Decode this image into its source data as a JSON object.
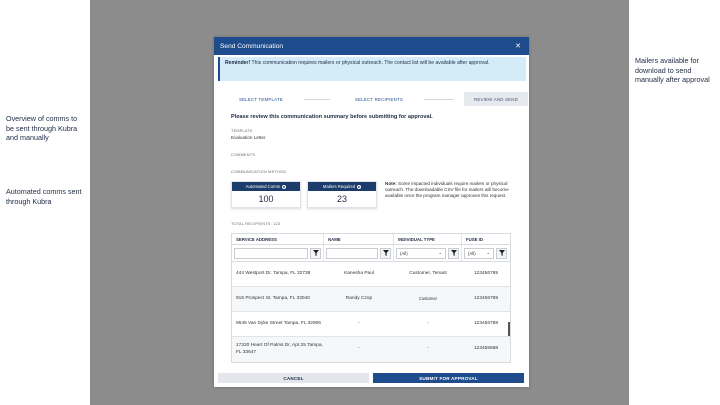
{
  "annotations": {
    "left_top": "Overview of comms to be sent through Kubra and manually",
    "left_bottom": "Automated comms sent through Kubra",
    "right_top": "Mailers available for download to send manually after approval"
  },
  "modal": {
    "title": "Send Communication",
    "close_icon": "close-icon",
    "reminder_bold": "Reminder!",
    "reminder_text": " This communication requires mailers or physical outreach. The contact list will be available after approval."
  },
  "steps": [
    {
      "label": "SELECT TEMPLATE",
      "active": false
    },
    {
      "label": "SELECT RECIPIENTS",
      "active": false
    },
    {
      "label": "REVIEW AND SEND",
      "active": true
    }
  ],
  "summary": {
    "title": "Please review this communication summary before submitting for approval.",
    "template_label": "TEMPLATE",
    "template_value": "Evaluation Letter",
    "comments_label": "COMMENTS",
    "method_label": "COMMUNICATION METHOD"
  },
  "cards": {
    "automated": {
      "label": "Automated Comm",
      "value": "100"
    },
    "mailers": {
      "label": "Mailers Required",
      "value": "23"
    }
  },
  "note": {
    "bold": "Note:",
    "text": " Some impacted individuals require mailers or physical outreach. The downloadable CSV file for mailers will become available once the program manager approves this request."
  },
  "table": {
    "total_label": "TOTAL RECIPIENTS: 123",
    "headers": [
      "SERVICE ADDRESS",
      "NAME",
      "INDIVIDUAL TYPE",
      "FUSE ID"
    ],
    "filters": {
      "type": "(All)",
      "fuse": "(All)"
    },
    "rows": [
      {
        "address": "444 Westport Dr. Tampa, FL 32738",
        "name": "Kanesha Paul",
        "type": "Customer, Tenant",
        "fuse": "123456789"
      },
      {
        "address": "915 Prospect St. Tampa, FL 33040",
        "name": "Randy Czop",
        "type": "Customer",
        "fuse": "123456789"
      },
      {
        "address": "9645 Van Dyke Street Tampa, FL 32806",
        "name": "-",
        "type": "-",
        "fuse": "123456788"
      },
      {
        "address": "17220 Heart Of Palms Dr, Apt 25 Tampa, FL 33647",
        "name": "-",
        "type": "-",
        "fuse": "123456688"
      }
    ]
  },
  "footer": {
    "cancel": "CANCEL",
    "submit": "SUBMIT FOR APPROVAL"
  }
}
